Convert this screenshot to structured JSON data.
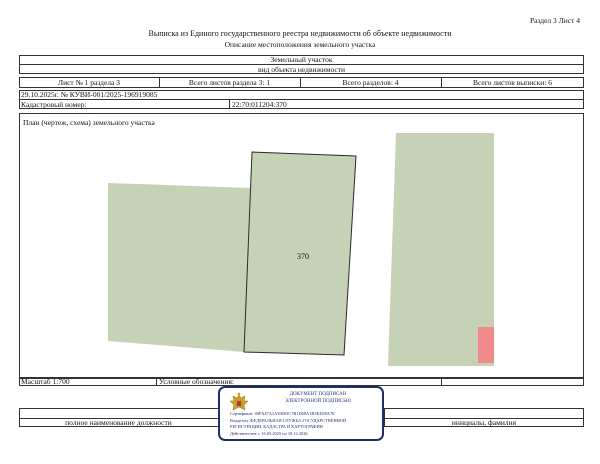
{
  "header": {
    "section_sheet": "Раздел 3   Лист 4",
    "title": "Выписка из Единого государственного реестра недвижимости об объекте недвижимости",
    "subtitle": "Описание местоположения земельного участка"
  },
  "object": {
    "type": "Земельный участок",
    "type_caption": "вид объекта недвижимости"
  },
  "sheet_info": {
    "sheet_of_section": "Лист № 1 раздела 3",
    "total_sheets_section": "Всего листов раздела 3: 1",
    "total_sections": "Всего разделов: 4",
    "total_sheets_extract": "Всего листов выписки: 6"
  },
  "doc": {
    "date_number": "29.10.2025г. № КУВИ-001/2025-196919085",
    "cadastral_label": "Кадастровый номер:",
    "cadastral_number": "22:70:011204:370"
  },
  "plan": {
    "title": "План (чертеж, схема) земельного участка",
    "parcel_label": "370",
    "colors": {
      "parcel_fill": "#c5d2b6",
      "parcel_stroke": "#2a2a2a",
      "highlight_fill": "#f08a8a"
    }
  },
  "footer": {
    "scale": "Масштаб 1:700",
    "legend_label": "Условные обозначения:",
    "position_caption": "полное наименование должности",
    "name_caption": "инициалы, фамилия"
  },
  "stamp": {
    "line1": "ДОКУМЕНТ ПОДПИСАН",
    "line2": "ЭЛЕКТРОННОЙ ПОДПИСЬЮ",
    "certificate": "Сертификат: 00FA47A1A39003C7B1D68A1B3E4D8A7E",
    "owner": "Владелец: ФЕДЕРАЛЬНАЯ СЛУЖБА ГОСУДАРСТВЕННОЙ",
    "owner2": "РЕГИСТРАЦИИ, КАДАСТРА И КАРТОГРАФИИ",
    "validity": "Действителен: с 16.05.2025 по 18.12.2026",
    "colors": {
      "border": "#1f2f6a",
      "emblem": "#c9a227"
    },
    "emblem_icon": "double-headed-eagle-emblem"
  }
}
